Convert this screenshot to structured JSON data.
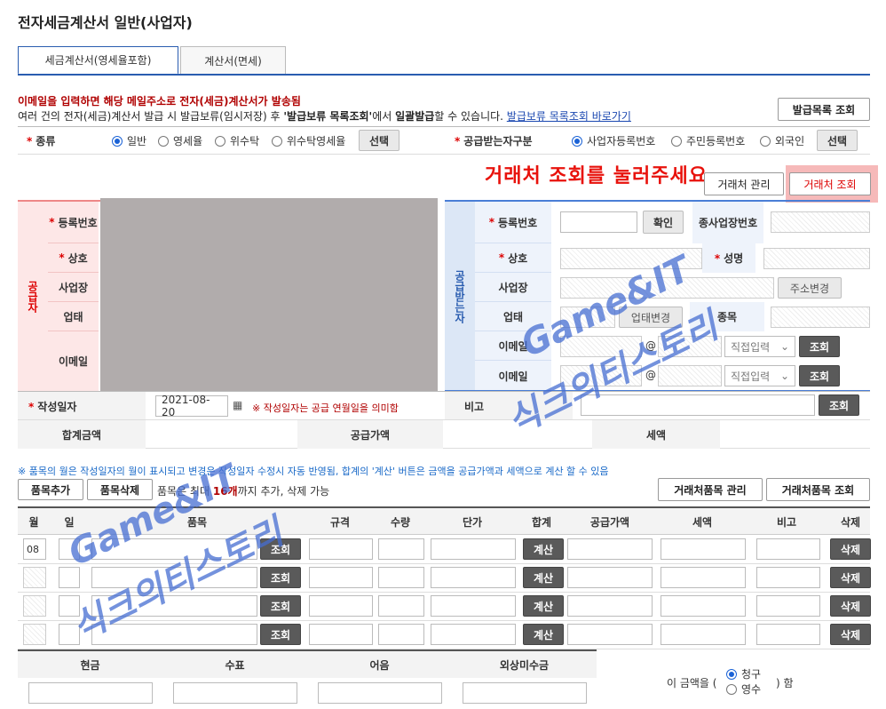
{
  "page": {
    "title": "전자세금계산서 일반(사업자)"
  },
  "tabs": [
    {
      "label": "세금계산서(영세율포함)",
      "active": true
    },
    {
      "label": "계산서(면세)",
      "active": false
    }
  ],
  "notice": {
    "line1": "이메일을 입력하면 해당 메일주소로 전자(세금)계산서가 발송됨",
    "line2_a": "여러 건의 전자(세금)계산서 발급 시 발급보류(임시저장) 후 ",
    "line2_b": "'발급보류 목록조회'",
    "line2_c": "에서 ",
    "line2_d": "일괄발급",
    "line2_e": "할 수 있습니다. ",
    "link": "발급보류 목록조회 바로가기",
    "issue_list_btn": "발급목록 조회"
  },
  "type_row": {
    "label": "종류",
    "options": [
      "일반",
      "영세율",
      "위수탁",
      "위수탁영세율"
    ],
    "selected": 0,
    "select_btn": "선택",
    "buyer_type_label": "공급받는자구분",
    "buyer_options": [
      "사업자등록번호",
      "주민등록번호",
      "외국인"
    ],
    "buyer_selected": 0,
    "buyer_select_btn": "선택"
  },
  "instruction": "거래처 조회를 눌러주세요",
  "partner_manage_btn": "거래처 관리",
  "partner_search_btn": "거래처 조회",
  "supplier": {
    "side": "공급자",
    "fields": [
      "등록번호",
      "상호",
      "사업장",
      "업태",
      "이메일"
    ]
  },
  "buyer": {
    "side": "공급받는자",
    "reg_label": "등록번호",
    "confirm_btn": "확인",
    "subreg_label": "종사업장번호",
    "name_label": "상호",
    "rep_label": "성명",
    "addr_label": "사업장",
    "addr_btn": "주소변경",
    "biz_label": "업태",
    "biz_btn": "업태변경",
    "item_label": "종목",
    "email_label": "이메일",
    "email_at": "@",
    "email_select": "직접입력",
    "email_btn": "조회"
  },
  "date_row": {
    "label": "작성일자",
    "value": "2021-08-20",
    "hint": "※ 작성일자는 공급 연월일을 의미함",
    "memo_label": "비고",
    "memo_btn": "조회"
  },
  "totals": {
    "total": "합계금액",
    "supply": "공급가액",
    "tax": "세액"
  },
  "items": {
    "note": "※ 품목의 월은 작성일자의 월이 표시되고 변경은 작성일자 수정시 자동 반영됨, 합계의 '계산' 버튼은 금액을 공급가액과 세액으로 계산 할 수 있음",
    "add_btn": "품목추가",
    "del_btn": "품목삭제",
    "limit_a": "품목은 최대 ",
    "limit_b": "16개",
    "limit_c": "까지 추가, 삭제 가능",
    "manage_btn": "거래처품목 관리",
    "search_btn": "거래처품목 조회",
    "headers": [
      "월",
      "일",
      "품목",
      "규격",
      "수량",
      "단가",
      "합계",
      "공급가액",
      "세액",
      "비고",
      "삭제"
    ],
    "rows": [
      {
        "month": "08",
        "search": "조회",
        "calc": "계산",
        "del": "삭제"
      },
      {
        "month": "",
        "search": "조회",
        "calc": "계산",
        "del": "삭제"
      },
      {
        "month": "",
        "search": "조회",
        "calc": "계산",
        "del": "삭제"
      },
      {
        "month": "",
        "search": "조회",
        "calc": "계산",
        "del": "삭제"
      }
    ]
  },
  "payment": {
    "headers": [
      "현금",
      "수표",
      "어음",
      "외상미수금"
    ],
    "amount_a": "이 금액을 (",
    "claim": "청구",
    "receipt": "영수",
    "amount_b": ") 함",
    "selected": "claim"
  },
  "watermark": {
    "line1": "Game&IT",
    "line2": "식크의티스토리"
  }
}
